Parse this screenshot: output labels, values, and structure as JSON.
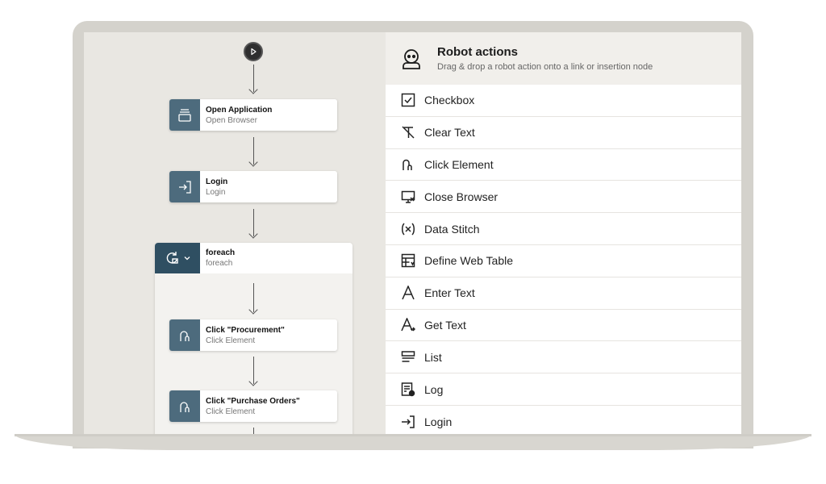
{
  "flow": {
    "nodes": [
      {
        "title": "Open Application",
        "subtitle": "Open Browser"
      },
      {
        "title": "Login",
        "subtitle": "Login"
      }
    ],
    "loop": {
      "title": "foreach",
      "subtitle": "foreach",
      "children": [
        {
          "title": "Click \"Procurement\"",
          "subtitle": "Click Element"
        },
        {
          "title": "Click \"Purchase Orders\"",
          "subtitle": "Click Element"
        }
      ]
    }
  },
  "panel": {
    "title": "Robot actions",
    "subtitle": "Drag & drop a robot action onto a link or insertion node",
    "actions": [
      {
        "label": "Checkbox",
        "icon": "checkbox-icon"
      },
      {
        "label": "Clear Text",
        "icon": "clear-text-icon"
      },
      {
        "label": "Click Element",
        "icon": "mouse-click-icon"
      },
      {
        "label": "Close Browser",
        "icon": "close-browser-icon"
      },
      {
        "label": "Data Stitch",
        "icon": "data-stitch-icon"
      },
      {
        "label": "Define Web Table",
        "icon": "web-table-icon"
      },
      {
        "label": "Enter Text",
        "icon": "enter-text-icon"
      },
      {
        "label": "Get Text",
        "icon": "get-text-icon"
      },
      {
        "label": "List",
        "icon": "list-icon"
      },
      {
        "label": "Log",
        "icon": "log-icon"
      },
      {
        "label": "Login",
        "icon": "login-icon"
      }
    ]
  },
  "colors": {
    "node_icon_bg": "#4d6b7d",
    "loop_icon_bg": "#2f4f62",
    "canvas_bg": "#e9e7e2",
    "panel_header_bg": "#f1efeb"
  }
}
